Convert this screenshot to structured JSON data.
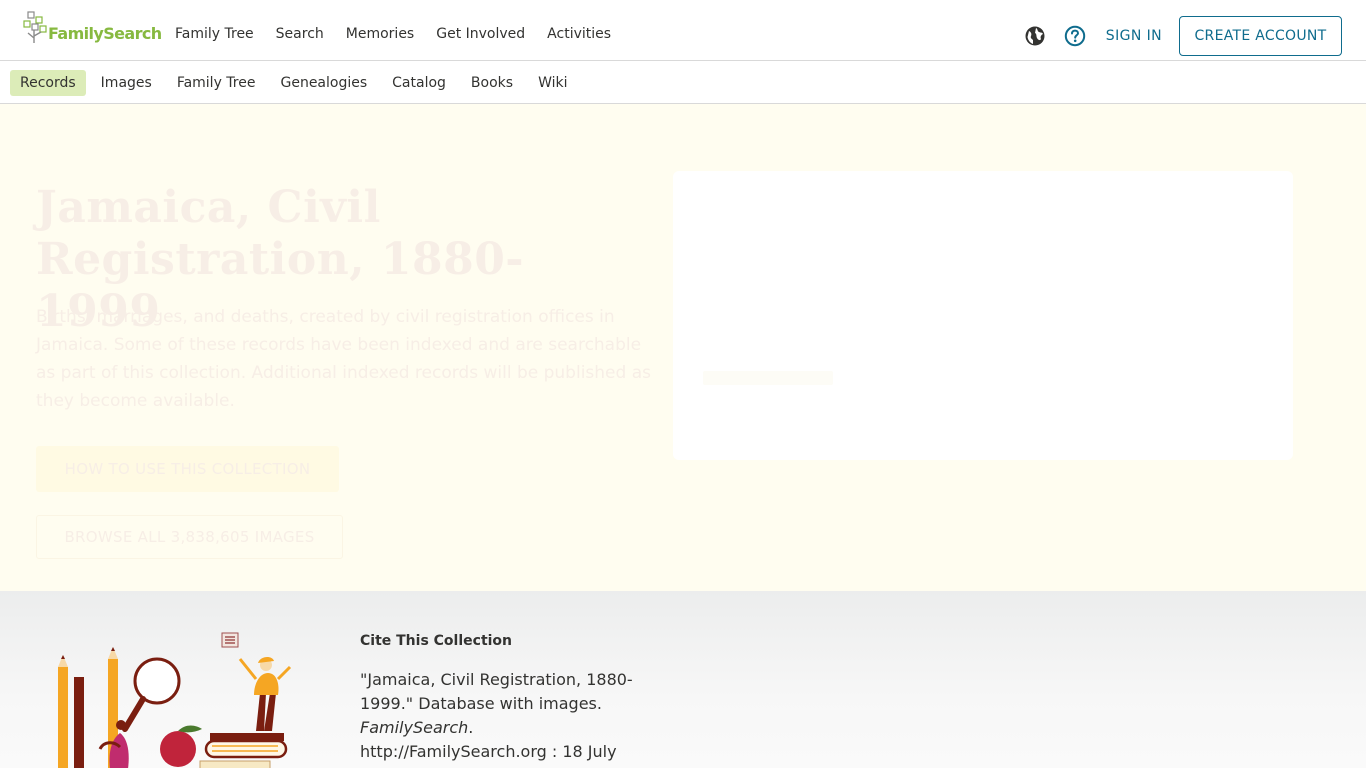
{
  "header": {
    "logo_text": "FamilySearch",
    "nav": [
      {
        "label": "Family Tree"
      },
      {
        "label": "Search"
      },
      {
        "label": "Memories"
      },
      {
        "label": "Get Involved"
      },
      {
        "label": "Activities"
      }
    ],
    "sign_in": "SIGN IN",
    "create_account": "CREATE ACCOUNT",
    "icons": [
      "globe-icon",
      "help-icon"
    ]
  },
  "subnav": {
    "items": [
      {
        "label": "Records",
        "active": true
      },
      {
        "label": "Images"
      },
      {
        "label": "Family Tree"
      },
      {
        "label": "Genealogies"
      },
      {
        "label": "Catalog"
      },
      {
        "label": "Books"
      },
      {
        "label": "Wiki"
      }
    ]
  },
  "hero": {
    "title": "Jamaica, Civil Registration, 1880-1999",
    "description": "Births, marriages, and deaths, created by civil registration offices in Jamaica. Some of these records have been indexed and are searchable as part of this collection. Additional indexed records will be published as they become available.",
    "how_to_button": "HOW TO USE THIS COLLECTION",
    "browse_button": "BROWSE ALL 3,838,605 IMAGES"
  },
  "cite": {
    "heading": "Cite This Collection",
    "text_part1": "\"Jamaica, Civil Registration, 1880-1999.\" Database with images.",
    "text_italic": "FamilySearch",
    "text_part2": ". http://FamilySearch.org : 18 July"
  },
  "colors": {
    "brand_green": "#87b940",
    "link_blue": "#0f6c8d",
    "active_tab": "#dcecb8",
    "hero_bg": "#fffdf0"
  }
}
